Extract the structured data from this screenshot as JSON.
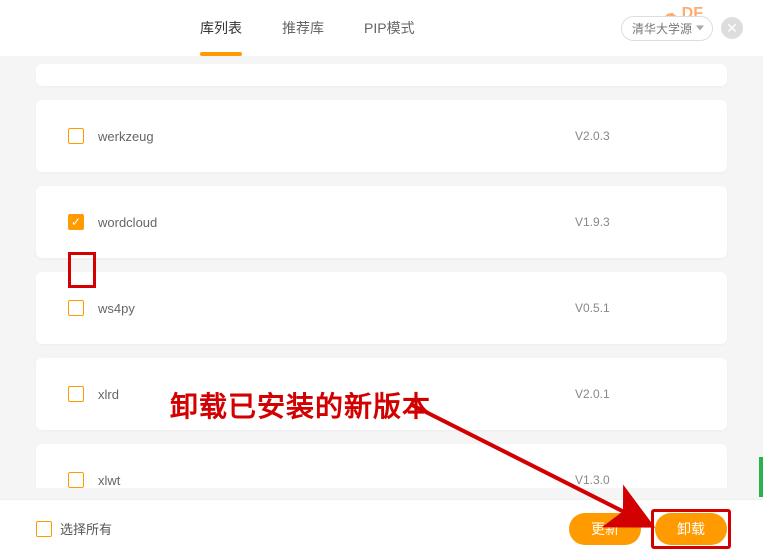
{
  "header": {
    "tabs": [
      "库列表",
      "推荐库",
      "PIP模式"
    ],
    "active_tab": 0,
    "source_label": "清华大学源",
    "watermark": "DF"
  },
  "libraries": [
    {
      "name": "werkzeug",
      "version": "V2.0.3",
      "checked": false
    },
    {
      "name": "wordcloud",
      "version": "V1.9.3",
      "checked": true
    },
    {
      "name": "ws4py",
      "version": "V0.5.1",
      "checked": false
    },
    {
      "name": "xlrd",
      "version": "V2.0.1",
      "checked": false
    },
    {
      "name": "xlwt",
      "version": "V1.3.0",
      "checked": false
    }
  ],
  "footer": {
    "select_all_label": "选择所有",
    "update_label": "更新",
    "uninstall_label": "卸载"
  },
  "annotation": {
    "text": "卸载已安装的新版本",
    "highlight_checkbox_index": 1,
    "highlight_button": "uninstall"
  }
}
